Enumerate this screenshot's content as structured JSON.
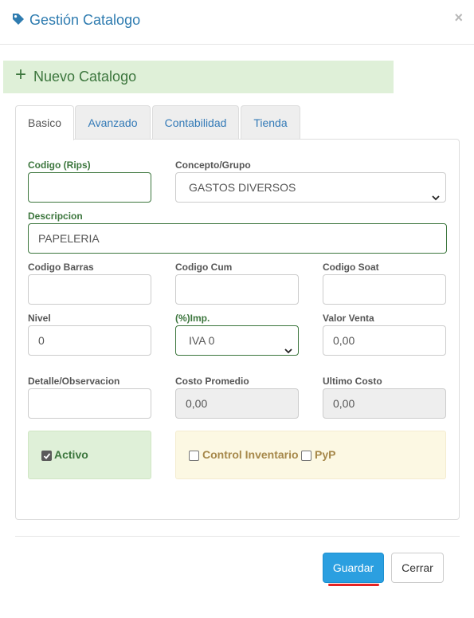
{
  "modal": {
    "title": "Gestión Catalogo",
    "close_label": "×"
  },
  "banner": {
    "icon": "+",
    "label": "Nuevo Catalogo"
  },
  "tabs": [
    {
      "label": "Basico",
      "active": true
    },
    {
      "label": "Avanzado",
      "active": false
    },
    {
      "label": "Contabilidad",
      "active": false
    },
    {
      "label": "Tienda",
      "active": false
    }
  ],
  "form": {
    "codigo_rips": {
      "label": "Codigo (Rips)",
      "value": ""
    },
    "concepto_grupo": {
      "label": "Concepto/Grupo",
      "value": "GASTOS DIVERSOS"
    },
    "descripcion": {
      "label": "Descripcion",
      "value": "PAPELERIA"
    },
    "codigo_barras": {
      "label": "Codigo Barras",
      "value": ""
    },
    "codigo_cum": {
      "label": "Codigo Cum",
      "value": ""
    },
    "codigo_soat": {
      "label": "Codigo Soat",
      "value": ""
    },
    "nivel": {
      "label": "Nivel",
      "value": "0"
    },
    "impuesto": {
      "label": "(%)Imp.",
      "value": "IVA 0"
    },
    "valor_venta": {
      "label": "Valor Venta",
      "value": "0,00"
    },
    "detalle": {
      "label": "Detalle/Observacion",
      "value": ""
    },
    "costo_promedio": {
      "label": "Costo Promedio",
      "value": "0,00"
    },
    "ultimo_costo": {
      "label": "Ultimo Costo",
      "value": "0,00"
    },
    "activo": {
      "label": "Activo",
      "checked": true
    },
    "control_inventario": {
      "label": "Control Inventario",
      "checked": false
    },
    "pyp": {
      "label": "PyP",
      "checked": false
    }
  },
  "footer": {
    "save_label": "Guardar",
    "close_label": "Cerrar"
  },
  "colors": {
    "title_blue": "#2f7cb0",
    "success_green": "#3c763d",
    "success_bg": "#dff0d8",
    "warning_text": "#a6884a",
    "warning_bg": "#fcf8e3",
    "primary_button": "#2b9fe0",
    "underline_red": "#e52424"
  }
}
